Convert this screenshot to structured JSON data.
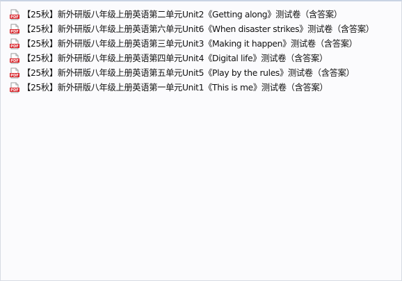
{
  "files": [
    {
      "name": "【25秋】新外研版八年级上册英语第二单元Unit2《Getting along》测试卷（含答案）",
      "icon": "pdf-file-icon"
    },
    {
      "name": "【25秋】新外研版八年级上册英语第六单元Unit6《When disaster strikes》测试卷（含答案）",
      "icon": "pdf-file-icon"
    },
    {
      "name": "【25秋】新外研版八年级上册英语第三单元Unit3《Making it happen》测试卷（含答案）",
      "icon": "pdf-file-icon"
    },
    {
      "name": "【25秋】新外研版八年级上册英语第四单元Unit4《Digital life》测试卷（含答案）",
      "icon": "pdf-file-icon"
    },
    {
      "name": "【25秋】新外研版八年级上册英语第五单元Unit5《Play by the rules》测试卷（含答案）",
      "icon": "pdf-file-icon"
    },
    {
      "name": "【25秋】新外研版八年级上册英语第一单元Unit1《This is me》测试卷（含答案）",
      "icon": "pdf-file-icon"
    }
  ],
  "colors": {
    "pdf_red": "#d9262c",
    "text": "#111111",
    "background": "#fbfbfd"
  }
}
